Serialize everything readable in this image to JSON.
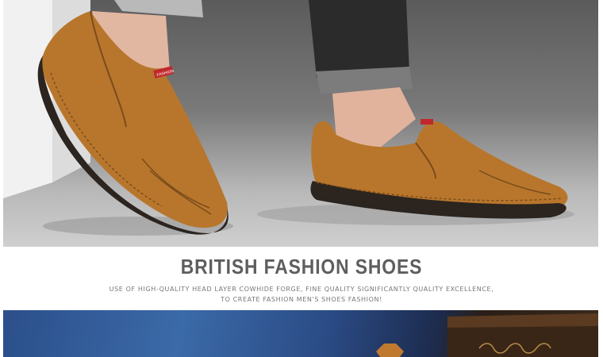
{
  "hero": {
    "title": "BRITISH FASHION SHOES",
    "subtitle_line1": "USE OF HIGH-QUALITY HEAD LAYER COWHIDE FORGE, FINE QUALITY SIGNIFICANTLY QUALITY EXCELLENCE,",
    "subtitle_line2": "TO CREATE FASHION MEN'S SHOES FASHION!"
  },
  "product_photo": {
    "tag_text": "FASHION",
    "accent_colors": {
      "leather": "#b8762c",
      "sole": "#2b241f",
      "tag": "#c0282c"
    }
  }
}
